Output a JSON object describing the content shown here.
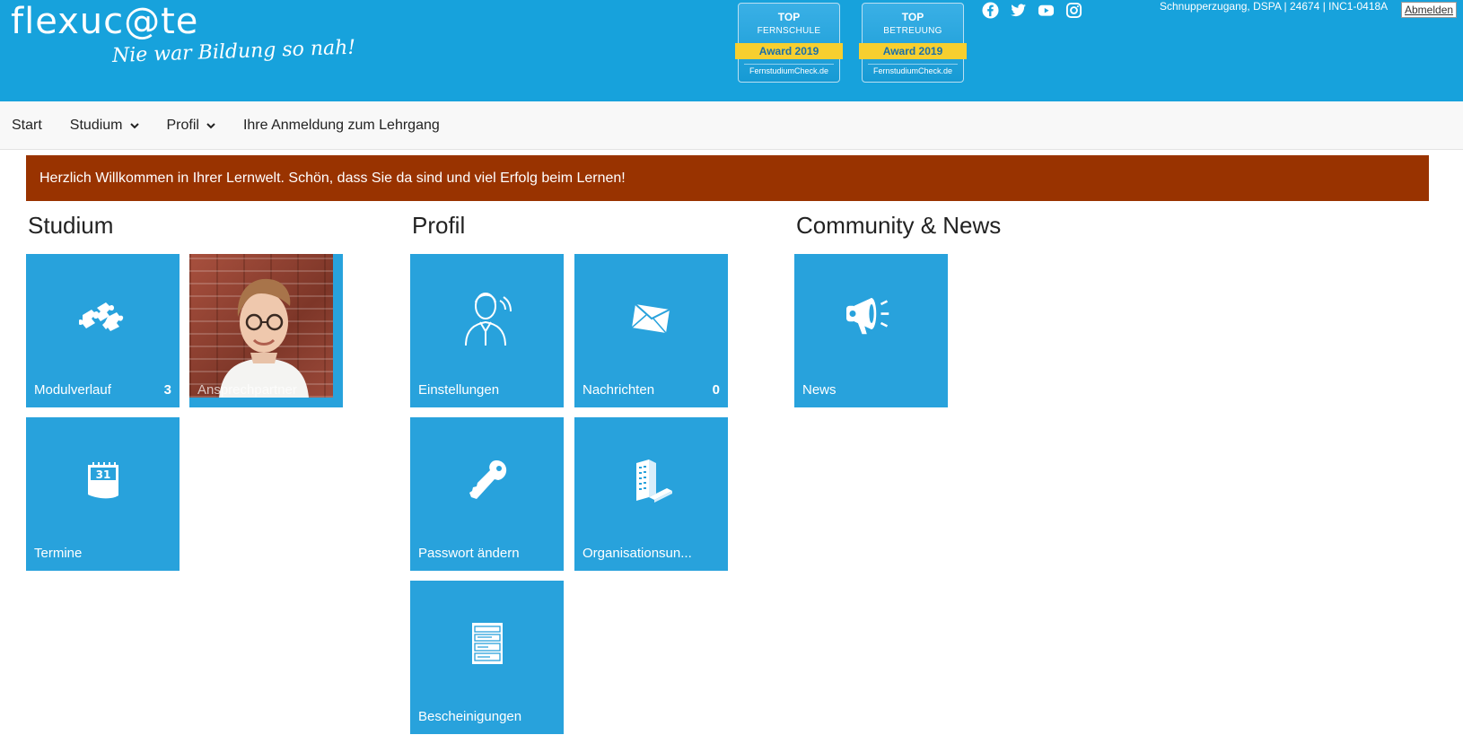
{
  "header": {
    "logo": "flexuc@te",
    "slogan": "Nie war Bildung so nah!",
    "awards": [
      {
        "top": "TOP",
        "sub": "FERNSCHULE",
        "band": "Award 2019",
        "site": "FernstudiumCheck.de"
      },
      {
        "top": "TOP",
        "sub": "BETREUUNG",
        "band": "Award 2019",
        "site": "FernstudiumCheck.de"
      }
    ],
    "social": [
      "facebook-icon",
      "twitter-icon",
      "youtube-icon",
      "instagram-icon"
    ],
    "user_info": "Schnupperzugang, DSPA | 24674 | INC1-0418A",
    "logout_label": "Abmelden"
  },
  "nav": {
    "items": [
      {
        "label": "Start"
      },
      {
        "label": "Studium"
      },
      {
        "label": "Profil"
      },
      {
        "label": "Ihre Anmeldung zum Lehrgang"
      }
    ]
  },
  "welcome": "Herzlich Willkommen in Ihrer Lernwelt. Schön, dass Sie da sind und viel Erfolg beim Lernen!",
  "sections": {
    "studium": {
      "title": "Studium",
      "tiles": [
        {
          "label": "Modulverlauf",
          "count": "3",
          "icon": "puzzle-icon"
        },
        {
          "label": "Ansprechpartner",
          "icon": "contact-photo"
        },
        {
          "label": "Termine",
          "icon": "calendar-icon",
          "icon_text": "31"
        }
      ]
    },
    "profil": {
      "title": "Profil",
      "tiles": [
        {
          "label": "Einstellungen",
          "icon": "person-icon"
        },
        {
          "label": "Nachrichten",
          "count": "0",
          "icon": "envelope-icon"
        },
        {
          "label": "Passwort ändern",
          "icon": "key-icon"
        },
        {
          "label": "Organisationsun...",
          "icon": "building-icon"
        },
        {
          "label": "Bescheinigungen",
          "icon": "document-icon"
        }
      ]
    },
    "community": {
      "title": "Community & News",
      "tiles": [
        {
          "label": "News",
          "icon": "megaphone-icon"
        }
      ]
    }
  },
  "colors": {
    "header_bg": "#17a2dc",
    "tile_bg": "#28a2dc",
    "welcome_bg": "#993300",
    "award_band": "#f7cf2f"
  }
}
